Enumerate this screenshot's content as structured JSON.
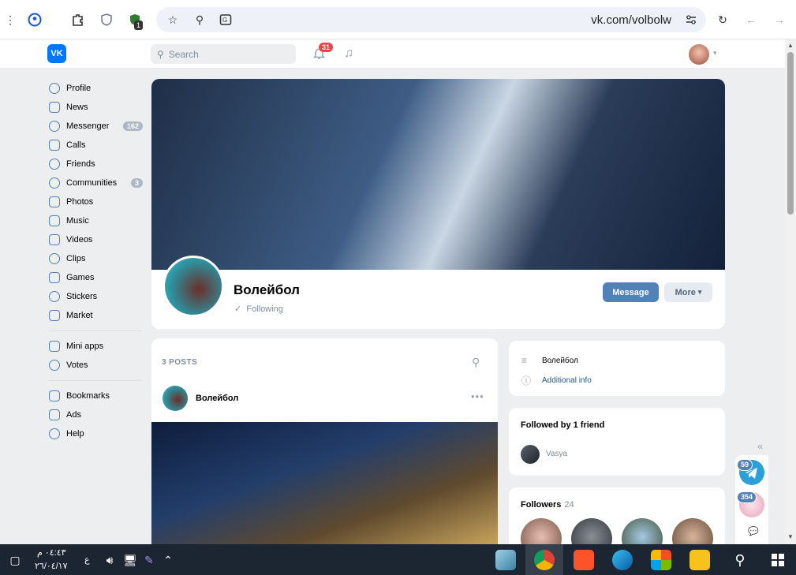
{
  "browser": {
    "url": "vk.com/volbolw",
    "extension_badge": "1"
  },
  "header": {
    "search_placeholder": "Search",
    "notifications_count": "31"
  },
  "sidebar": {
    "items": [
      {
        "label": "Profile",
        "icon": "profile-icon"
      },
      {
        "label": "News",
        "icon": "news-icon"
      },
      {
        "label": "Messenger",
        "icon": "messenger-icon",
        "count": "162"
      },
      {
        "label": "Calls",
        "icon": "phone-icon"
      },
      {
        "label": "Friends",
        "icon": "friends-icon"
      },
      {
        "label": "Communities",
        "icon": "communities-icon",
        "count": "3"
      },
      {
        "label": "Photos",
        "icon": "photos-icon"
      },
      {
        "label": "Music",
        "icon": "music-icon"
      },
      {
        "label": "Videos",
        "icon": "videos-icon"
      },
      {
        "label": "Clips",
        "icon": "clips-icon"
      },
      {
        "label": "Games",
        "icon": "games-icon"
      },
      {
        "label": "Stickers",
        "icon": "stickers-icon"
      },
      {
        "label": "Market",
        "icon": "market-icon"
      }
    ],
    "items2": [
      {
        "label": "Mini apps",
        "icon": "mini-apps-icon"
      },
      {
        "label": "Votes",
        "icon": "votes-icon"
      }
    ],
    "items3": [
      {
        "label": "Bookmarks",
        "icon": "bookmark-icon"
      },
      {
        "label": "Ads",
        "icon": "ads-icon"
      },
      {
        "label": "Help",
        "icon": "help-icon"
      }
    ]
  },
  "group": {
    "name": "Волейбол",
    "following_label": "Following",
    "message_button": "Message",
    "more_button": "More"
  },
  "wall": {
    "posts_label": "3 POSTS",
    "post_author": "Волейбол"
  },
  "info": {
    "description": "Волейбол",
    "additional_info": "Additional info"
  },
  "friends": {
    "title": "Followed by 1 friend",
    "friend_name": "Vasya"
  },
  "followers": {
    "title": "Followers",
    "count": "24"
  },
  "dock": {
    "chat1_badge": "59",
    "chat2_badge": "354"
  },
  "taskbar": {
    "time": "٠٤:٤٣ م",
    "date": "٢٦/٠٤/١٧",
    "lang": "ع"
  },
  "colors": {
    "vk_blue": "#0077ff",
    "button_blue": "#5181b8",
    "badge_red": "#e64646"
  }
}
